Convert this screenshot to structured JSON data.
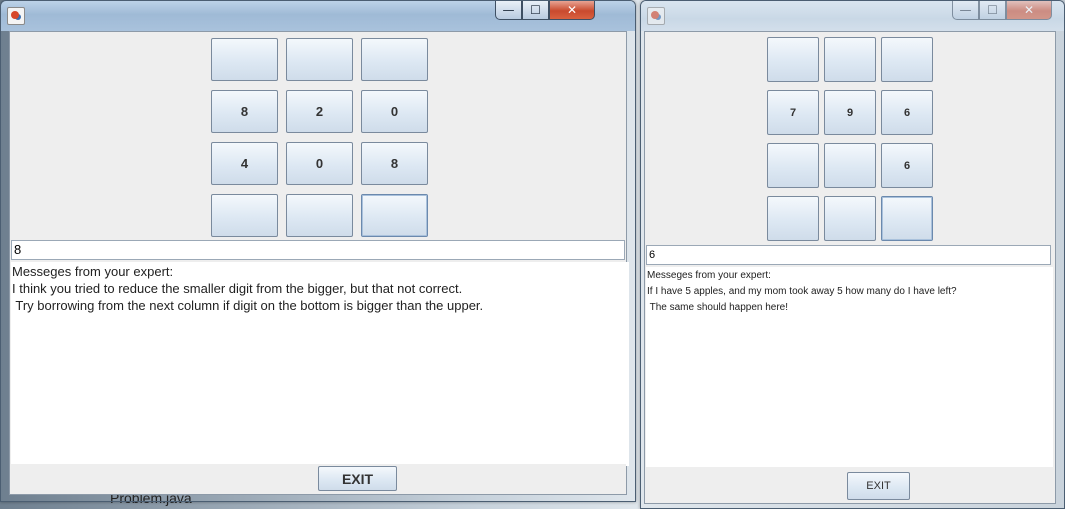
{
  "background": {
    "label": "Problem.java"
  },
  "windows": [
    {
      "id": "left",
      "rows": [
        [
          "",
          "",
          ""
        ],
        [
          "8",
          "2",
          "0"
        ],
        [
          "4",
          "0",
          "8"
        ],
        [
          "",
          "",
          ""
        ]
      ],
      "answer": "8",
      "message_header": "Messeges from your expert:",
      "message_lines": [
        "I think you tried to reduce the smaller digit from the bigger, but that not correct.",
        " Try borrowing from the next column if digit on the bottom is bigger than the upper."
      ],
      "exit_label": "EXIT"
    },
    {
      "id": "right",
      "rows": [
        [
          "",
          "",
          ""
        ],
        [
          "7",
          "9",
          "6"
        ],
        [
          "",
          "",
          "6"
        ],
        [
          "",
          "",
          ""
        ]
      ],
      "answer": "6",
      "message_header": "Messeges from your expert:",
      "message_lines": [
        "If I have 5 apples, and my mom took away 5 how many do I have left?",
        " The same should happen here!"
      ],
      "exit_label": "EXIT"
    }
  ],
  "caption_buttons": {
    "minimize": "—",
    "maximize": "☐",
    "close": "✕"
  },
  "colors": {
    "titlebar": "#a9c2dc",
    "close": "#c94a2e",
    "panel": "#eeeeee"
  }
}
